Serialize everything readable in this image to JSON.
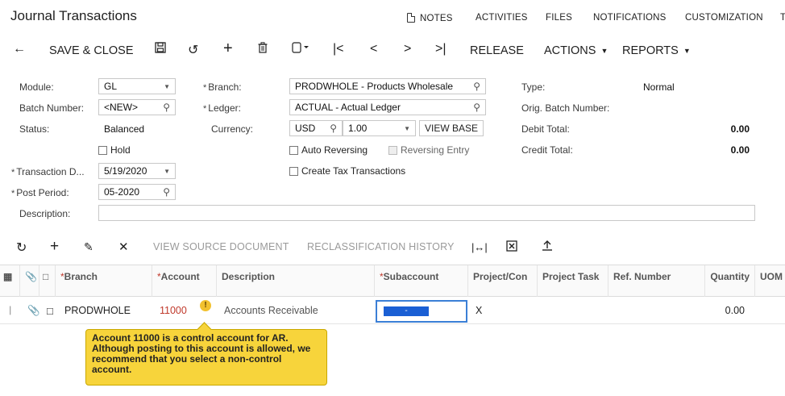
{
  "header": {
    "title": "Journal Transactions",
    "nav": [
      "NOTES",
      "ACTIVITIES",
      "FILES",
      "NOTIFICATIONS",
      "CUSTOMIZATION",
      "T"
    ]
  },
  "toolbar": {
    "save_close": "SAVE & CLOSE",
    "release": "RELEASE",
    "actions": "ACTIONS",
    "reports": "REPORTS"
  },
  "form": {
    "module_label": "Module:",
    "module_value": "GL",
    "batch_label": "Batch Number:",
    "batch_value": "<NEW>",
    "status_label": "Status:",
    "status_value": "Balanced",
    "hold_label": "Hold",
    "trandate_label": "Transaction D...",
    "trandate_value": "5/19/2020",
    "postperiod_label": "Post Period:",
    "postperiod_value": "05-2020",
    "description_label": "Description:",
    "description_value": "",
    "branch_label": "Branch:",
    "branch_value": "PRODWHOLE - Products Wholesale",
    "ledger_label": "Ledger:",
    "ledger_value": "ACTUAL - Actual Ledger",
    "currency_label": "Currency:",
    "currency_value": "USD",
    "rate_value": "1.00",
    "view_base": "VIEW BASE",
    "auto_reversing": "Auto Reversing",
    "reversing_entry": "Reversing Entry",
    "create_tax": "Create Tax Transactions",
    "type_label": "Type:",
    "type_value": "Normal",
    "orig_batch_label": "Orig. Batch Number:",
    "debit_label": "Debit Total:",
    "debit_value": "0.00",
    "credit_label": "Credit Total:",
    "credit_value": "0.00"
  },
  "grid_toolbar": {
    "view_source": "VIEW SOURCE DOCUMENT",
    "reclass_history": "RECLASSIFICATION HISTORY"
  },
  "grid": {
    "headers": {
      "branch": "Branch",
      "account": "Account",
      "description": "Description",
      "subaccount": "Subaccount",
      "project": "Project/Con",
      "project_task": "Project Task",
      "ref_number": "Ref. Number",
      "quantity": "Quantity",
      "uom": "UOM"
    },
    "row": {
      "branch": "PRODWHOLE",
      "account": "11000",
      "description": "Accounts Receivable",
      "subaccount": "-",
      "project": "X",
      "quantity": "0.00"
    }
  },
  "warning": {
    "text": "Account 11000 is a control account for AR. Although posting to this account is allowed, we recommend that you select a non-control account."
  },
  "colors": {
    "accent": "#1a5fd4",
    "warning": "#f7d43b",
    "account_red": "#c0392b"
  }
}
